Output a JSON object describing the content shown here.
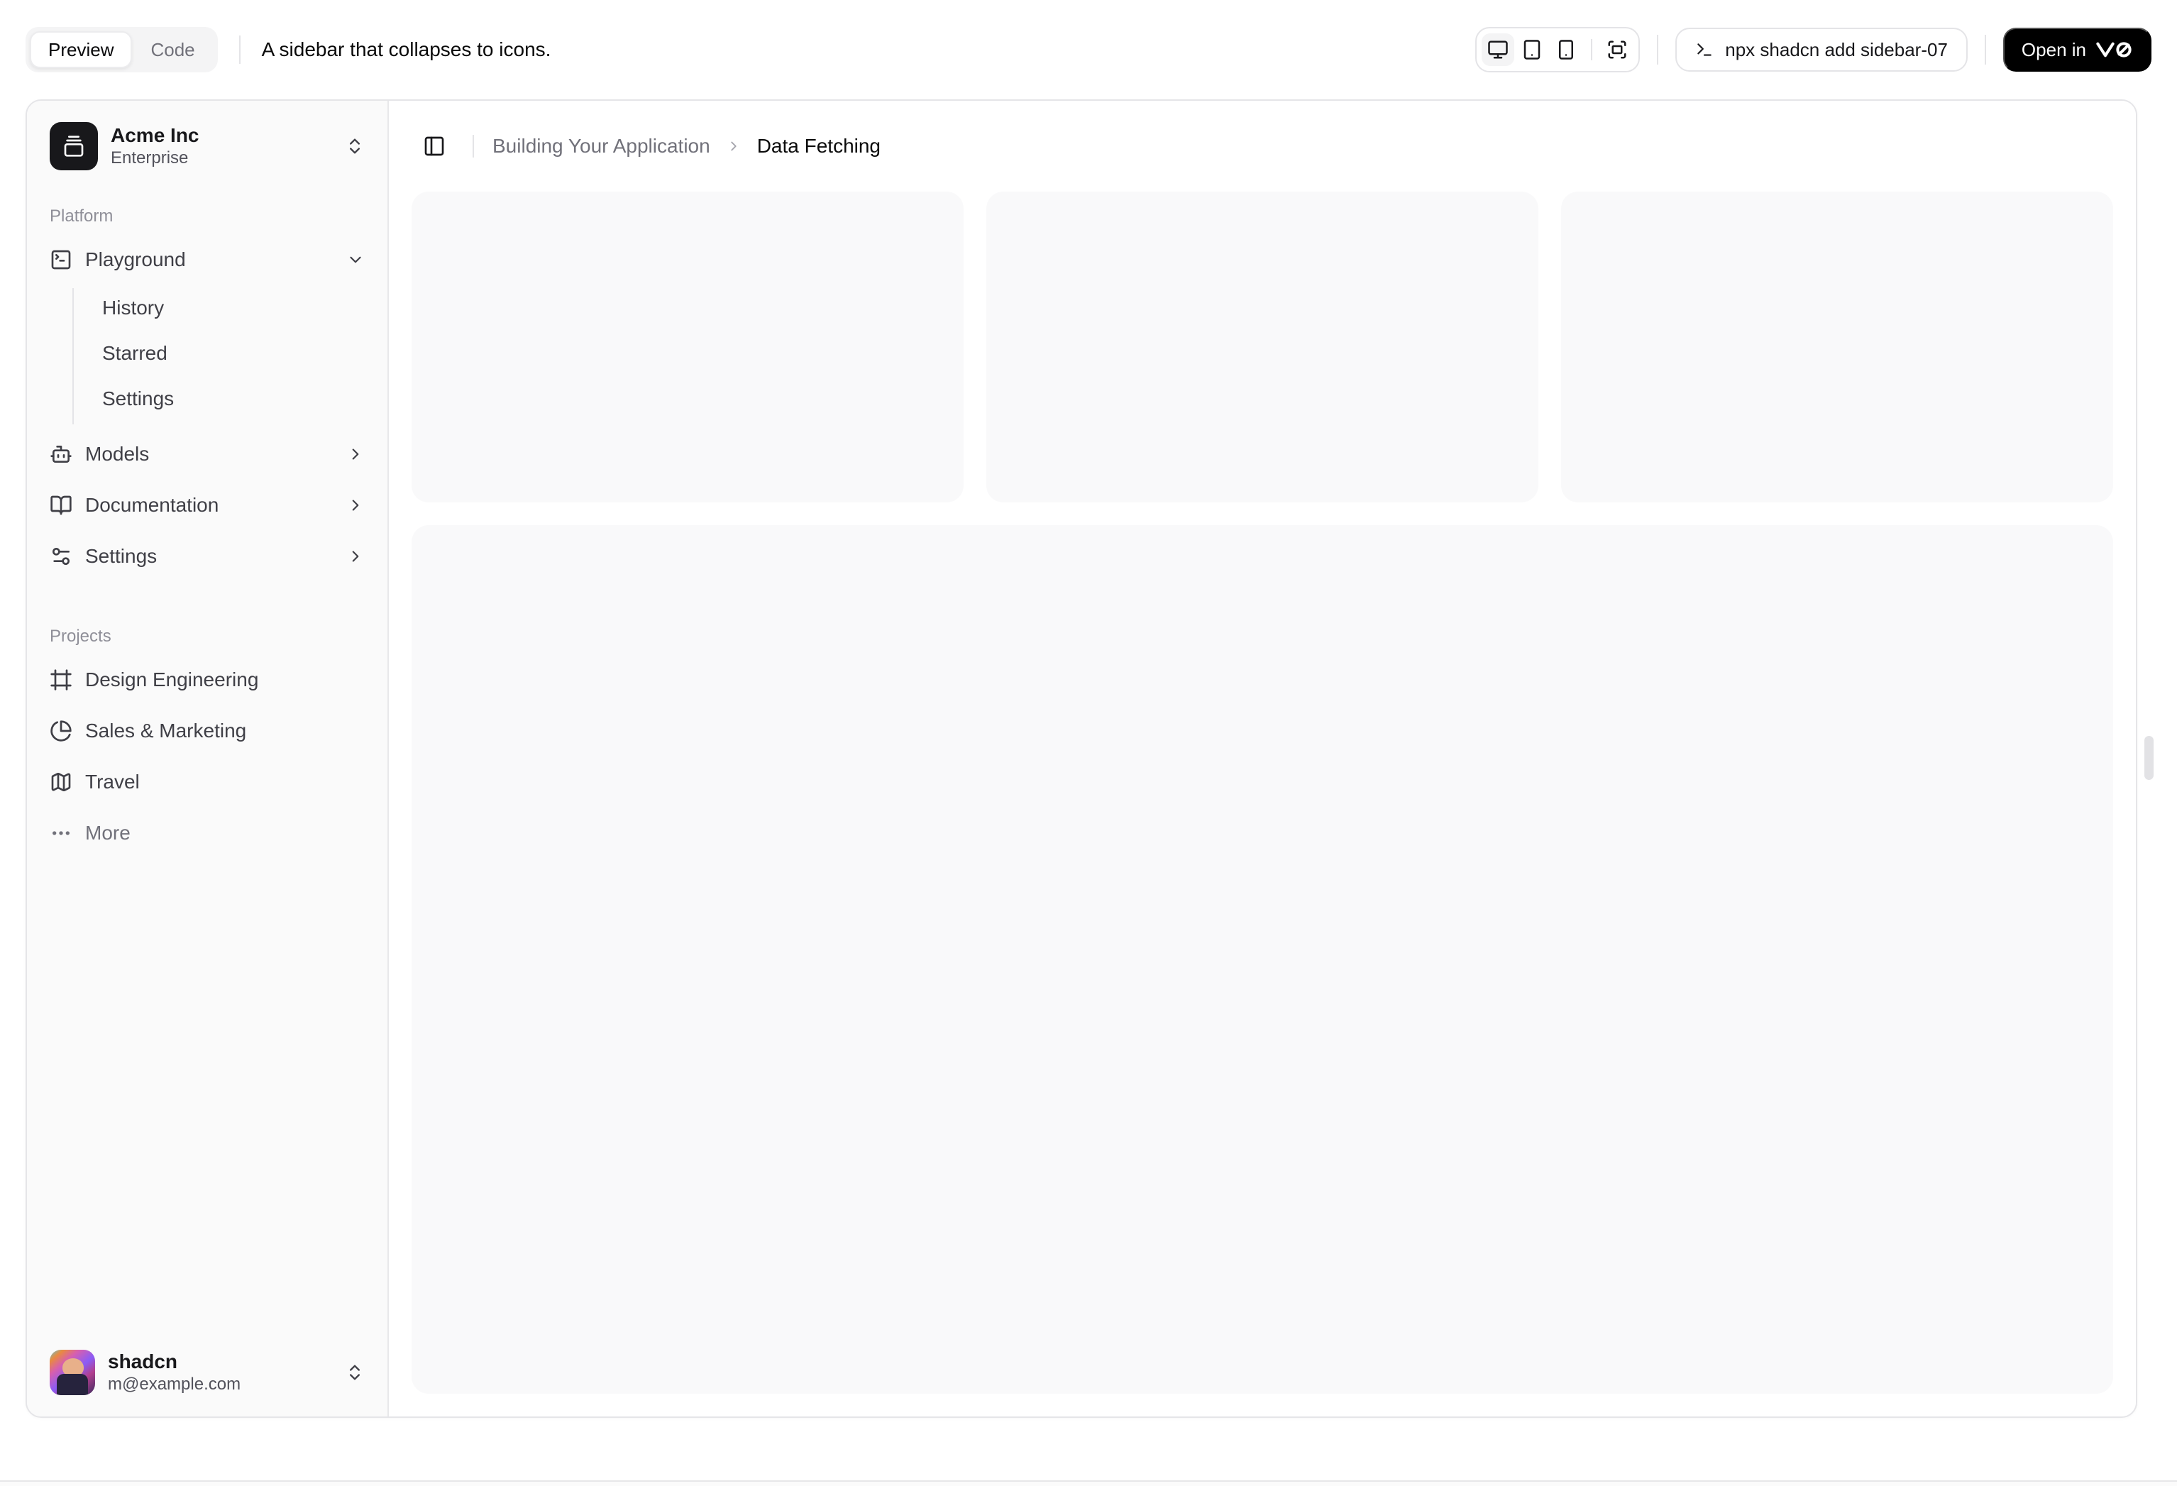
{
  "toolbar": {
    "tabs": [
      {
        "label": "Preview",
        "active": true
      },
      {
        "label": "Code",
        "active": false
      }
    ],
    "description": "A sidebar that collapses to icons.",
    "device_toggles": [
      {
        "name": "desktop",
        "icon": "monitor-icon",
        "active": true
      },
      {
        "name": "tablet",
        "icon": "tablet-icon",
        "active": false
      },
      {
        "name": "mobile",
        "icon": "smartphone-icon",
        "active": false
      },
      {
        "name": "fullscreen",
        "icon": "fullscreen-icon",
        "active": false
      }
    ],
    "command": "npx shadcn add sidebar-07",
    "open_in_label": "Open in",
    "open_in_logo": "v0"
  },
  "sidebar": {
    "team": {
      "name": "Acme Inc",
      "plan": "Enterprise",
      "logo_icon": "gallery-vertical-end-icon"
    },
    "groups": [
      {
        "label": "Platform",
        "items": [
          {
            "label": "Playground",
            "icon": "square-terminal-icon",
            "state": "expanded",
            "children": [
              {
                "label": "History"
              },
              {
                "label": "Starred"
              },
              {
                "label": "Settings"
              }
            ]
          },
          {
            "label": "Models",
            "icon": "bot-icon",
            "state": "collapsed"
          },
          {
            "label": "Documentation",
            "icon": "book-open-icon",
            "state": "collapsed"
          },
          {
            "label": "Settings",
            "icon": "settings-2-icon",
            "state": "collapsed"
          }
        ]
      },
      {
        "label": "Projects",
        "items": [
          {
            "label": "Design Engineering",
            "icon": "frame-icon"
          },
          {
            "label": "Sales & Marketing",
            "icon": "pie-chart-icon"
          },
          {
            "label": "Travel",
            "icon": "map-icon"
          },
          {
            "label": "More",
            "icon": "ellipsis-icon",
            "muted": true
          }
        ]
      }
    ],
    "user": {
      "name": "shadcn",
      "email": "m@example.com"
    }
  },
  "main": {
    "breadcrumb": {
      "parent": "Building Your Application",
      "current": "Data Fetching"
    }
  },
  "colors": {
    "accent": "#000000",
    "border": "#e4e4e7",
    "sidebar_bg": "#fafafa",
    "placeholder_bg": "#f9f9fa",
    "text": "#09090b",
    "muted_text": "#71717a",
    "sidebar_text": "#3f3f46"
  }
}
